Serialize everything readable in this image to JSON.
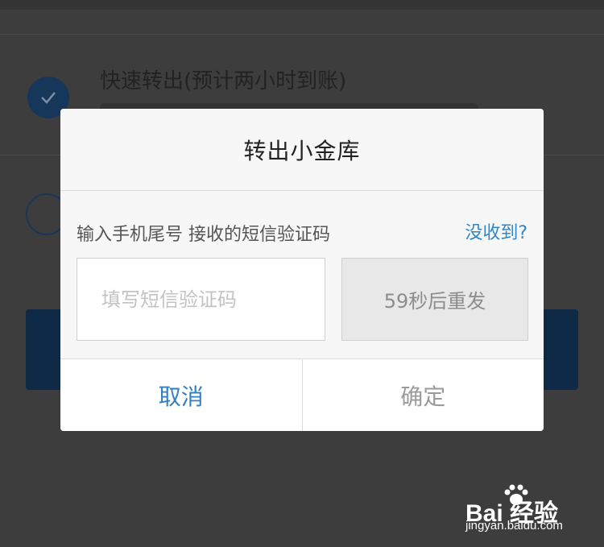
{
  "background": {
    "option_fast_title": "快速转出(预计两小时到账)"
  },
  "dialog": {
    "title": "转出小金库",
    "hint": "输入手机尾号      接收的短信验证码",
    "not_received_link": "没收到?",
    "code_input": {
      "value": "",
      "placeholder": "填写短信验证码"
    },
    "resend_button": "59秒后重发",
    "cancel_button": "取消",
    "confirm_button": "确定"
  },
  "watermark": {
    "logo_text": "Bai  经验",
    "url": "jingyan.baidu.com"
  },
  "colors": {
    "accent_blue": "#2f7fc2",
    "radio_dark_blue": "#16365a",
    "overlay": "#3d3d3d"
  }
}
